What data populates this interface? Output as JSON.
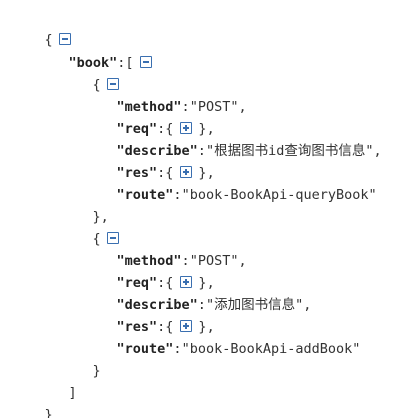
{
  "root": {
    "open": "{",
    "close": "}",
    "array_key": "\"book\"",
    "array_open": ":[",
    "array_close": "]"
  },
  "items": [
    {
      "open": "{",
      "close": "},",
      "method": {
        "key": "\"method\"",
        "value": "\"POST\""
      },
      "req": {
        "key": "\"req\"",
        "open": ":{",
        "close": "}"
      },
      "describe": {
        "key": "\"describe\"",
        "value": "\"根据图书id查询图书信息\""
      },
      "res": {
        "key": "\"res\"",
        "open": ":{",
        "close": "}"
      },
      "route": {
        "key": "\"route\"",
        "value": "\"book-BookApi-queryBook\""
      }
    },
    {
      "open": "{",
      "close": "}",
      "method": {
        "key": "\"method\"",
        "value": "\"POST\""
      },
      "req": {
        "key": "\"req\"",
        "open": ":{",
        "close": "}"
      },
      "describe": {
        "key": "\"describe\"",
        "value": "\"添加图书信息\""
      },
      "res": {
        "key": "\"res\"",
        "open": ":{",
        "close": "}"
      },
      "route": {
        "key": "\"route\"",
        "value": "\"book-BookApi-addBook\""
      }
    }
  ],
  "punct": {
    "colon": ":",
    "comma": ","
  },
  "icons": {
    "collapse": "minus-box-icon",
    "expand": "plus-box-icon",
    "accent": "#3a6fb0"
  }
}
